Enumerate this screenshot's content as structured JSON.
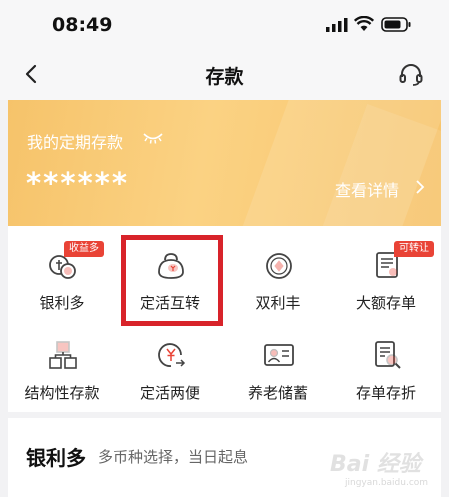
{
  "status_bar": {
    "time": "08:49"
  },
  "nav": {
    "title": "存款"
  },
  "banner": {
    "label": "我的定期存款",
    "masked_balance": "******",
    "detail_link": "查看详情"
  },
  "grid": {
    "items": [
      {
        "label": "银利多",
        "badge": "收益多",
        "icon": "coins-icon"
      },
      {
        "label": "定活互转",
        "badge": "",
        "icon": "purse-icon"
      },
      {
        "label": "双利丰",
        "badge": "",
        "icon": "coin-diamond-icon"
      },
      {
        "label": "大额存单",
        "badge": "可转让",
        "icon": "certificate-icon"
      },
      {
        "label": "结构性存款",
        "badge": "",
        "icon": "structure-icon"
      },
      {
        "label": "定活两便",
        "badge": "",
        "icon": "yuan-exchange-icon"
      },
      {
        "label": "养老储蓄",
        "badge": "",
        "icon": "id-card-icon"
      },
      {
        "label": "存单存折",
        "badge": "",
        "icon": "passbook-search-icon"
      }
    ]
  },
  "section": {
    "title": "银利多",
    "subtitle": "多币种选择，当日起息"
  },
  "watermark": {
    "text": "Bai 经验",
    "sub": "jingyan.baidu.com"
  },
  "colors": {
    "accent_red": "#e94336",
    "highlight_red": "#d8232a",
    "banner_gold": "#f8c873",
    "icon_stroke": "#444444"
  }
}
